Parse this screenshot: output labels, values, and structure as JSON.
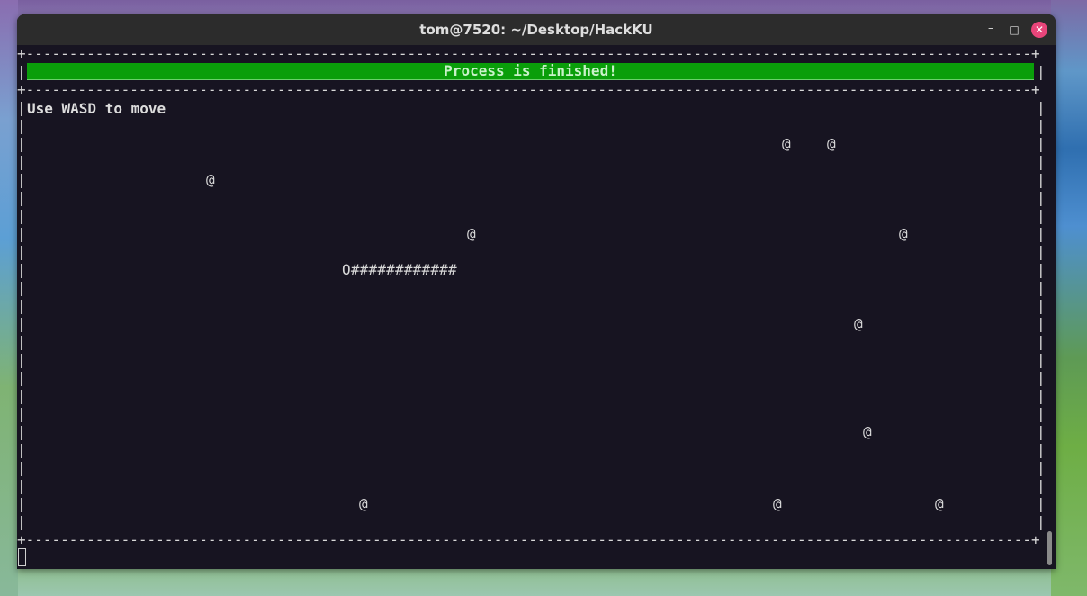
{
  "window": {
    "title": "tom@7520: ~/Desktop/HackKU",
    "min_glyph": "–",
    "max_glyph": "□",
    "close_glyph": "✕"
  },
  "terminal": {
    "border_top": "+---------------------------------------------------------------------------------------------------------------------------------+",
    "border_mid": "+---------------------------------------------------------------------------------------------------------------------------------+",
    "border_bottom": "+---------------------------------------------------------------------------------------------------------------------------------+",
    "side_bar": "|",
    "status_banner": "Process is finished!",
    "hint": "Use WASD to move",
    "food_glyph": "@",
    "snake": "O############"
  },
  "colors": {
    "banner_bg": "#0a9e0a",
    "terminal_bg": "#171421",
    "close_button": "#e8457a"
  }
}
